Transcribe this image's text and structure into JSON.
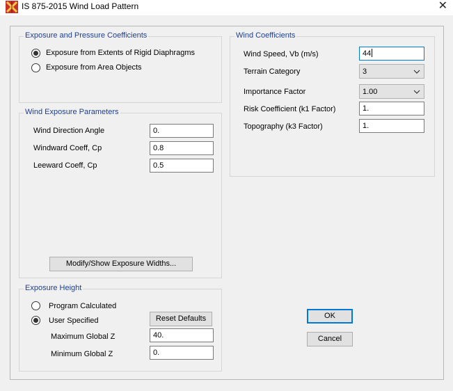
{
  "window": {
    "title": "IS 875-2015 Wind Load Pattern"
  },
  "exposure_pressure": {
    "title": "Exposure and Pressure Coefficients",
    "options": [
      {
        "label": "Exposure from Extents of Rigid Diaphragms",
        "selected": true
      },
      {
        "label": "Exposure from Area Objects",
        "selected": false
      }
    ]
  },
  "wind_exposure": {
    "title": "Wind Exposure Parameters",
    "direction_angle": {
      "label": "Wind Direction Angle",
      "value": "0."
    },
    "windward_coeff": {
      "label": "Windward Coeff, Cp",
      "value": "0.8"
    },
    "leeward_coeff": {
      "label": "Leeward Coeff, Cp",
      "value": "0.5"
    },
    "modify_button": "Modify/Show Exposure Widths..."
  },
  "exposure_height": {
    "title": "Exposure Height",
    "program_calculated": {
      "label": "Program Calculated",
      "selected": false
    },
    "user_specified": {
      "label": "User Specified",
      "selected": true
    },
    "reset_button": "Reset Defaults",
    "max_z": {
      "label": "Maximum Global  Z",
      "value": "40."
    },
    "min_z": {
      "label": "Minimum Global  Z",
      "value": "0."
    }
  },
  "wind_coefficients": {
    "title": "Wind Coefficients",
    "wind_speed": {
      "label": "Wind Speed, Vb (m/s)",
      "value": "44"
    },
    "terrain_category": {
      "label": "Terrain Category",
      "value": "3"
    },
    "importance_factor": {
      "label": "Importance Factor",
      "value": "1.00"
    },
    "risk_coefficient": {
      "label": "Risk Coefficient (k1 Factor)",
      "value": "1."
    },
    "topography": {
      "label": "Topography (k3 Factor)",
      "value": "1."
    }
  },
  "buttons": {
    "ok": "OK",
    "cancel": "Cancel"
  },
  "colors": {
    "group_title": "#1e3f8f",
    "focus_border": "#0078d7",
    "background": "#f0f0f0"
  },
  "icons": {
    "app": "etabs-app-icon",
    "close": "close-icon",
    "dropdown": "chevron-down-icon"
  }
}
